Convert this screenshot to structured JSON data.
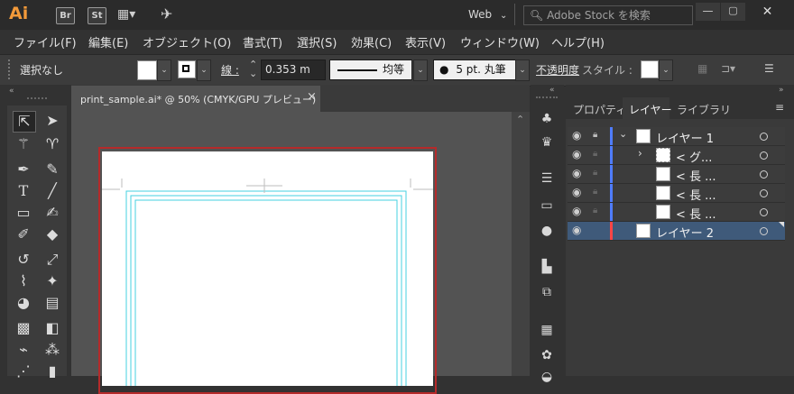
{
  "app": {
    "logo": "Ai",
    "badges": [
      "Br",
      "St"
    ],
    "workspace": "Web",
    "search_placeholder": "Adobe Stock を検索",
    "window_buttons": [
      "minimize-icon",
      "maximize-icon",
      "close-icon"
    ]
  },
  "menu": [
    "ファイル(F)",
    "編集(E)",
    "オブジェクト(O)",
    "書式(T)",
    "選択(S)",
    "効果(C)",
    "表示(V)",
    "ウィンドウ(W)",
    "ヘルプ(H)"
  ],
  "control": {
    "selection": "選択なし",
    "stroke_label": "線 :",
    "stroke_value": "0.353 m",
    "profile_label": "均等",
    "brush_label": "5 pt. 丸筆",
    "opacity_label": "不透明度",
    "style_label": "スタイル :"
  },
  "document": {
    "tab_title": "print_sample.ai* @ 50% (CMYK/GPU プレビュー)",
    "close_label": "×"
  },
  "panel": {
    "tabs": [
      "プロパティ",
      "レイヤー",
      "ライブラリ"
    ],
    "active_tab": "レイヤー",
    "layers": [
      {
        "name": "レイヤー 1",
        "indent": 0,
        "expanded": true,
        "color": "#4f7cff",
        "selected": false
      },
      {
        "name": "< グ...",
        "indent": 1,
        "expanded": false,
        "color": "#4f7cff",
        "selected": false
      },
      {
        "name": "< 長 ...",
        "indent": 2,
        "expanded": false,
        "color": "#4f7cff",
        "selected": false
      },
      {
        "name": "< 長 ...",
        "indent": 2,
        "expanded": false,
        "color": "#4f7cff",
        "selected": false
      },
      {
        "name": "< 長 ...",
        "indent": 2,
        "expanded": false,
        "color": "#4f7cff",
        "selected": false
      },
      {
        "name": "レイヤー 2",
        "indent": 0,
        "expanded": false,
        "color": "#ff4545",
        "selected": true
      }
    ]
  },
  "colors": {
    "accent": "#f39a3a",
    "artboard_border": "#b52a2a",
    "guide": "#45d0e0",
    "selected_row": "#3f5a7a"
  }
}
